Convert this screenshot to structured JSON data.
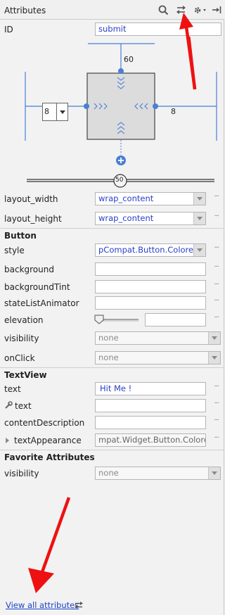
{
  "header": {
    "title": "Attributes"
  },
  "id_row": {
    "label": "ID",
    "value": "submit"
  },
  "constraints": {
    "top_margin": "60",
    "right_margin": "8",
    "left_margin_value": "8",
    "bias": "50"
  },
  "layout": {
    "width_label": "layout_width",
    "width_value": "wrap_content",
    "height_label": "layout_height",
    "height_value": "wrap_content"
  },
  "button_section": {
    "title": "Button",
    "rows": [
      {
        "label": "style",
        "value": "pCompat.Button.Colored"
      },
      {
        "label": "background",
        "value": ""
      },
      {
        "label": "backgroundTint",
        "value": ""
      },
      {
        "label": "stateListAnimator",
        "value": ""
      },
      {
        "label": "elevation",
        "value": ""
      },
      {
        "label": "visibility",
        "value": "none"
      },
      {
        "label": "onClick",
        "value": "none"
      }
    ]
  },
  "textview_section": {
    "title": "TextView",
    "rows": [
      {
        "label": "text",
        "value": "Hit Me !"
      },
      {
        "label": "text",
        "value": ""
      },
      {
        "label": "contentDescription",
        "value": ""
      },
      {
        "label": "textAppearance",
        "value": "mpat.Widget.Button.Colored"
      }
    ]
  },
  "favorites_section": {
    "title": "Favorite Attributes",
    "rows": [
      {
        "label": "visibility",
        "value": "none"
      }
    ]
  },
  "footer": {
    "link": "View all attributes"
  },
  "colors": {
    "accent_blue": "#4a7fd4",
    "annotation_red": "#ee1111",
    "link_blue": "#1b43c8"
  }
}
